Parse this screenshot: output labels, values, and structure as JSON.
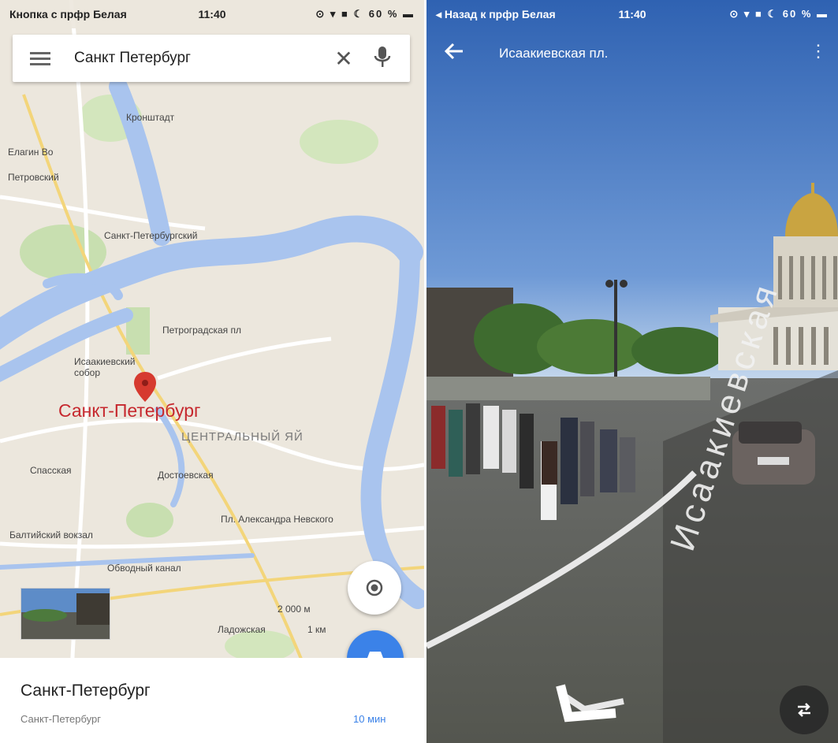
{
  "left_screen": {
    "status": {
      "carrier": "Кнопка с прфр Белая",
      "time": "11:40",
      "icons": "⊙ ▾ ■ ☾ 60 % ▬"
    },
    "search": {
      "query": "Санкт Петербург"
    },
    "map_labels": {
      "city": "Санкт-Петербург",
      "district": "ЦЕНТРАЛЬНЫЙ ЯЙ",
      "l1": "Кронштадт",
      "l2": "Петровский",
      "l3": "Елагин Во",
      "l4": "Санкт-Петербургский",
      "l5": "Петроградская пл",
      "l6": "Исаакиевский собор",
      "l7": "Спасская",
      "l8": "Достоевская",
      "l9": "Пл. Александра Невского",
      "l10": "Балтийский вокзал",
      "l11": "Обводный канал",
      "l12": "Ладожская"
    },
    "scale": {
      "primary": "2 000 м",
      "secondary": "1 км"
    },
    "place_sheet": {
      "title": "Санкт-Петербург",
      "subtitle": "Санкт-Петербург",
      "travel_time": "10 мин"
    }
  },
  "right_screen": {
    "status": {
      "carrier": "◂ Назад к прфр Белая",
      "time": "11:40",
      "icons": "⊙ ▾ ■ ☾ 60 % ▬"
    },
    "header": {
      "place": "Исаакиевская пл."
    },
    "road_marking": "Исаакиевская"
  },
  "colors": {
    "map_land": "#ece7dd",
    "map_water": "#a9c4ee",
    "map_park": "#c8dfb0",
    "marker_red": "#d63a2f",
    "fab_blue": "#3b82e8",
    "sky_top": "#2f62b2",
    "sky_bottom": "#cfdff0"
  },
  "icons": {
    "menu": "menu-icon",
    "clear": "close-icon",
    "mic": "microphone-icon",
    "location": "my-location-icon",
    "directions": "car-icon",
    "back": "back-arrow-icon",
    "more": "more-vertical-icon",
    "swap": "swap-view-icon"
  }
}
